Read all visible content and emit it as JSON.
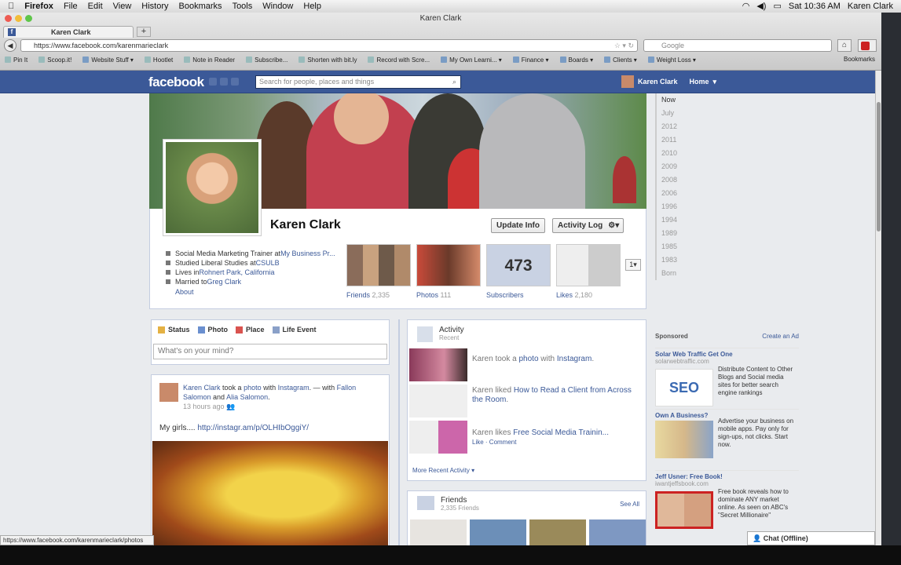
{
  "menubar": {
    "apple": "",
    "items": [
      "Firefox",
      "File",
      "Edit",
      "View",
      "History",
      "Bookmarks",
      "Tools",
      "Window",
      "Help"
    ],
    "clock": "Sat 10:36 AM",
    "user": "Karen Clark"
  },
  "window": {
    "title": "Karen Clark",
    "tab_title": "Karen Clark",
    "url": "https://www.facebook.com/karenmarieclark",
    "search_placeholder": "Google",
    "bookmarks": [
      "Pin It",
      "Scoop.it!",
      "Website Stuff",
      "Hootlet",
      "Note in Reader",
      "Subscribe...",
      "Shorten with bit.ly",
      "Record with Scre...",
      "My Own Learni...",
      "Finance",
      "Boards",
      "Clients",
      "Weight Loss"
    ],
    "bookmarks_menu": "Bookmarks",
    "status_url": "https://www.facebook.com/karenmarieclark/photos"
  },
  "fb": {
    "logo": "facebook",
    "search_placeholder": "Search for people, places and things",
    "user_name": "Karen Clark",
    "home": "Home"
  },
  "profile": {
    "name": "Karen Clark",
    "update_info": "Update Info",
    "activity_log": "Activity Log",
    "info_work": "Social Media Marketing Trainer at ",
    "info_work_link": "My Business Pr...",
    "info_study": "Studied Liberal Studies at ",
    "info_study_link": "CSULB",
    "info_lives": "Lives in ",
    "info_lives_link": "Rohnert Park, California",
    "info_married": "Married to ",
    "info_married_link": "Greg Clark",
    "about": "About",
    "friends_label": "Friends",
    "friends_count": "2,335",
    "photos_label": "Photos",
    "photos_count": "111",
    "subscribers_count": "473",
    "subscribers_label": "Subscribers",
    "likes_label": "Likes",
    "likes_count": "2,180",
    "more_num": "1"
  },
  "timeline_years": [
    "Now",
    "July",
    "2012",
    "2011",
    "2010",
    "2009",
    "2008",
    "2006",
    "1996",
    "1994",
    "1989",
    "1985",
    "1983",
    "Born"
  ],
  "composer": {
    "tabs": [
      "Status",
      "Photo",
      "Place",
      "Life Event"
    ],
    "placeholder": "What's on your mind?"
  },
  "post": {
    "author": "Karen Clark",
    "action": " took a ",
    "photo": "photo",
    "with": " with ",
    "app": "Instagram",
    "dash": ". — with ",
    "tag1": "Fallon Salomon",
    "and": " and ",
    "tag2": "Alia Salomon",
    "end": ".",
    "time": "13 hours ago",
    "text": "My girls.... ",
    "link": "http://instagr.am/p/OLHIbOggiY/"
  },
  "activity": {
    "title": "Activity",
    "subtitle": "Recent",
    "row1_a": "Karen took a ",
    "row1_link": "photo",
    "row1_b": " with ",
    "row1_link2": "Instagram",
    "row1_c": ".",
    "row2_a": "Karen liked ",
    "row2_link": "How to Read a Client from Across the Room",
    "row2_b": ".",
    "row3_a": "Karen likes ",
    "row3_link": "Free Social Media Trainin...",
    "row3_sub": "Like · Comment",
    "more": "More Recent Activity"
  },
  "friends_box": {
    "title": "Friends",
    "count": "2,335 Friends",
    "see_all": "See All"
  },
  "sponsored": {
    "label": "Sponsored",
    "create": "Create an Ad",
    "ads": [
      {
        "title": "Solar Web Traffic Get One",
        "url": "solarwebtraffic.com",
        "desc": "Distribute Content to Other Blogs and Social media sites for better search engine rankings",
        "img_text": "SEO"
      },
      {
        "title": "Own A Business?",
        "url": "",
        "desc": "Advertise your business on mobile apps. Pay only for sign-ups, not clicks. Start now.",
        "img_text": ""
      },
      {
        "title": "Jeff Usner: Free Book!",
        "url": "iwantjeffsbook.com",
        "desc": "Free book reveals how to dominate ANY market online. As seen on ABC's \"Secret Millionaire\"",
        "img_text": ""
      }
    ]
  },
  "chat": "Chat (Offline)"
}
